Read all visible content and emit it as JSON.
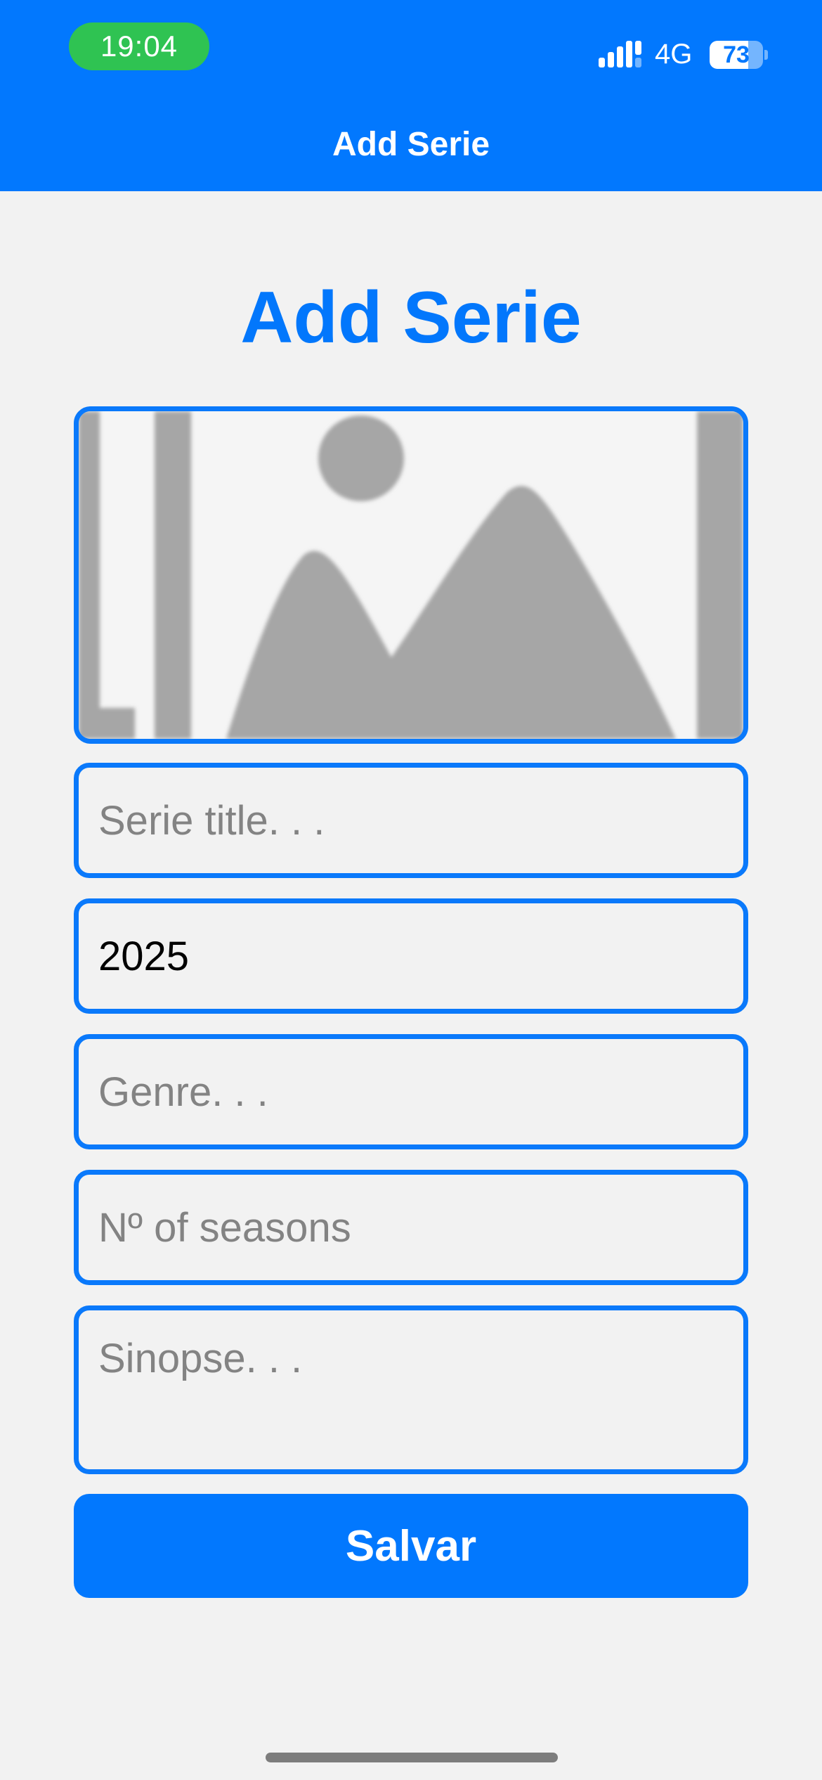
{
  "status_bar": {
    "time": "19:04",
    "network": "4G",
    "battery_percent": "73",
    "battery_level": 0.73
  },
  "nav": {
    "title": "Add Serie"
  },
  "page": {
    "heading": "Add Serie"
  },
  "image_picker": {
    "icon": "image-placeholder-icon"
  },
  "form": {
    "title_placeholder": "Serie title. . .",
    "title_value": "",
    "year_value": "2025",
    "genre_placeholder": "Genre. . .",
    "seasons_placeholder": "Nº of seasons",
    "sinopse_placeholder": "Sinopse. . ."
  },
  "actions": {
    "save_label": "Salvar"
  },
  "colors": {
    "brand": "#0278fe",
    "status_pill": "#2fc352",
    "background": "#f2f2f2",
    "placeholder": "#838383"
  }
}
